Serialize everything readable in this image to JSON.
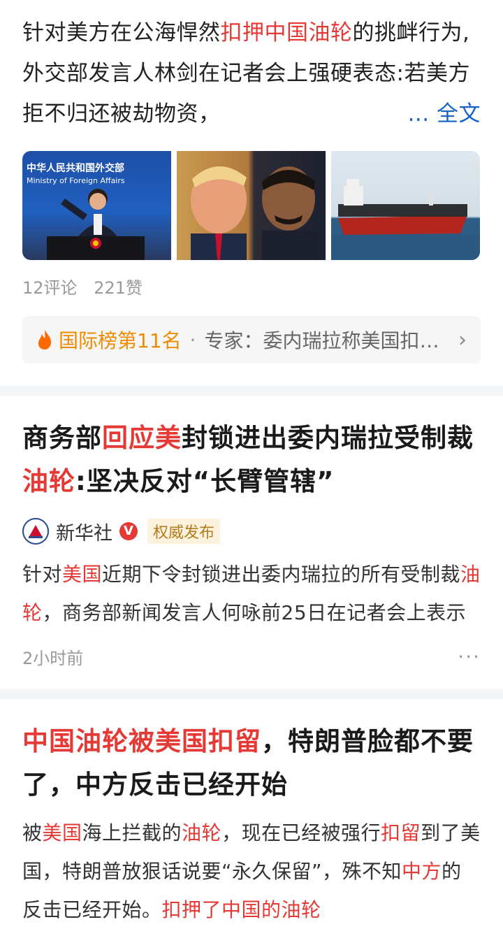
{
  "card1": {
    "summary_parts": [
      {
        "t": "针对美方在公海悍然",
        "hl": false
      },
      {
        "t": "扣押中国油轮",
        "hl": true
      },
      {
        "t": "的挑衅行为,外交部发言人林剑在记者会上强硬表态:若美方拒不归还被劫物资，",
        "hl": false
      }
    ],
    "more_label": "... 全文",
    "image1_text": [
      "中华人民共和国外交部",
      "Ministry of Foreign Affairs"
    ],
    "comments": "12评论",
    "likes": "221赞",
    "rank_label": "国际榜第11名",
    "rank_sep": "·",
    "rank_topic": "专家：委内瑞拉称美国扣押油轮",
    "chevron": "›"
  },
  "card2": {
    "title_parts": [
      {
        "t": "商务部",
        "hl": false
      },
      {
        "t": "回应美",
        "hl": true
      },
      {
        "t": "封锁进出委内瑞拉受制裁",
        "hl": false
      },
      {
        "t": "油轮",
        "hl": true
      },
      {
        "t": ":坚决反对“长臂管辖”",
        "hl": false
      }
    ],
    "source_name": "新华社",
    "verified": "V",
    "source_tag": "权威发布",
    "body_parts": [
      {
        "t": "针对",
        "hl": false
      },
      {
        "t": "美国",
        "hl": true
      },
      {
        "t": "近期下令封锁进出委内瑞拉的所有受制裁",
        "hl": false
      },
      {
        "t": "油轮",
        "hl": true
      },
      {
        "t": "，商务部新闻发言人何咏前25日在记者会上表示",
        "hl": false
      }
    ],
    "time": "2小时前",
    "more": "···"
  },
  "card3": {
    "title_parts": [
      {
        "t": "中国油轮被美国扣留",
        "hl": true
      },
      {
        "t": "，特朗普脸都不要了，中方反击已经开始",
        "hl": false
      }
    ],
    "body_parts": [
      {
        "t": "被",
        "hl": false
      },
      {
        "t": "美国",
        "hl": true
      },
      {
        "t": "海上拦截的",
        "hl": false
      },
      {
        "t": "油轮",
        "hl": true
      },
      {
        "t": "，现在已经被强行",
        "hl": false
      },
      {
        "t": "扣留",
        "hl": true
      },
      {
        "t": "到了美国，特朗普放狠话说要“永久保留”，殊不知",
        "hl": false
      },
      {
        "t": "中方",
        "hl": true
      },
      {
        "t": "的反击已经开始。",
        "hl": false
      },
      {
        "t": "扣押了中国的油轮",
        "hl": true
      }
    ]
  },
  "colors": {
    "highlight": "#e53935",
    "link": "#1565c0",
    "rank": "#f08a00",
    "tag_bg": "#fdf3dd"
  }
}
